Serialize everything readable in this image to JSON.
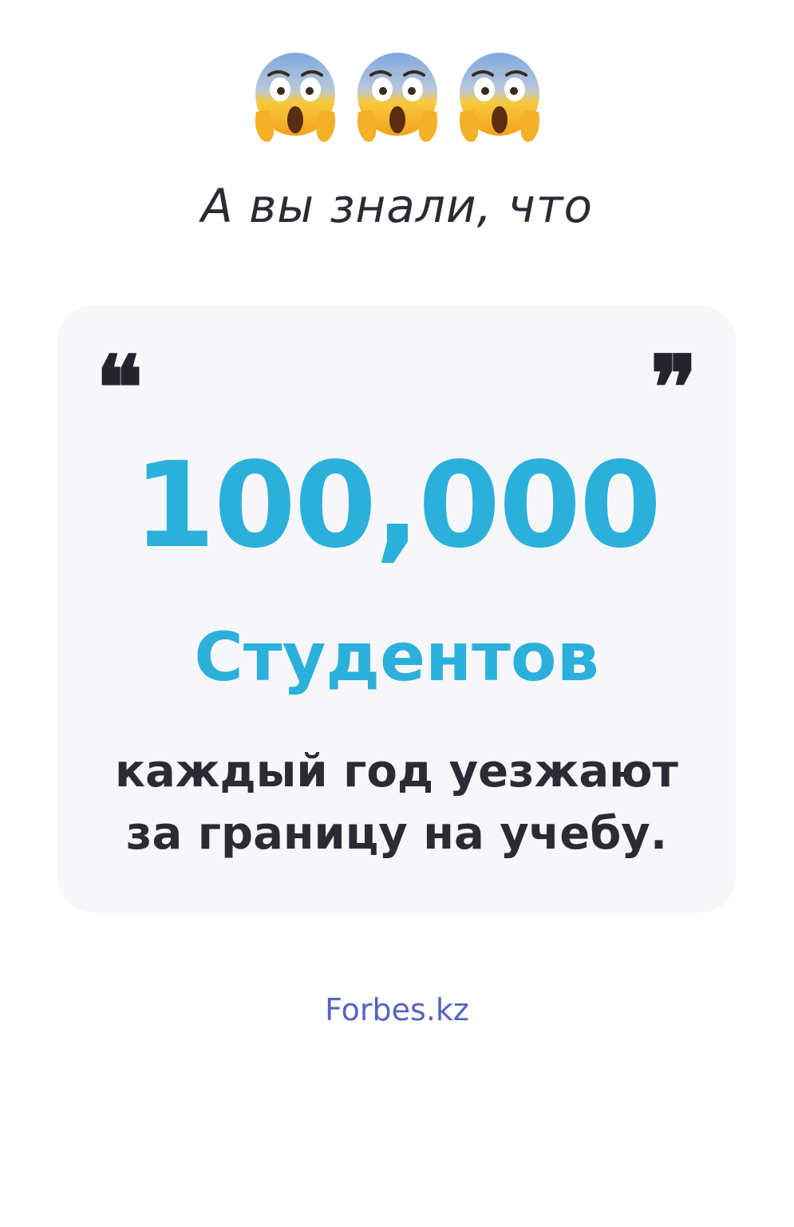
{
  "header": {
    "emoji_icons": [
      "face-screaming-in-fear-icon",
      "face-screaming-in-fear-icon",
      "face-screaming-in-fear-icon"
    ],
    "intro_text": "А вы знали, что"
  },
  "card": {
    "quote_open": "❝",
    "quote_close": "❞",
    "big_number": "100,000",
    "highlight": "Студентов",
    "description_line1": "каждый год уезжают",
    "description_line2": "за границу на учебу."
  },
  "footer": {
    "source": "Forbes.kz"
  },
  "colors": {
    "accent": "#2bb0dc",
    "text": "#2b2b33",
    "source": "#5563c1",
    "card_bg": "#f7f7fa"
  }
}
